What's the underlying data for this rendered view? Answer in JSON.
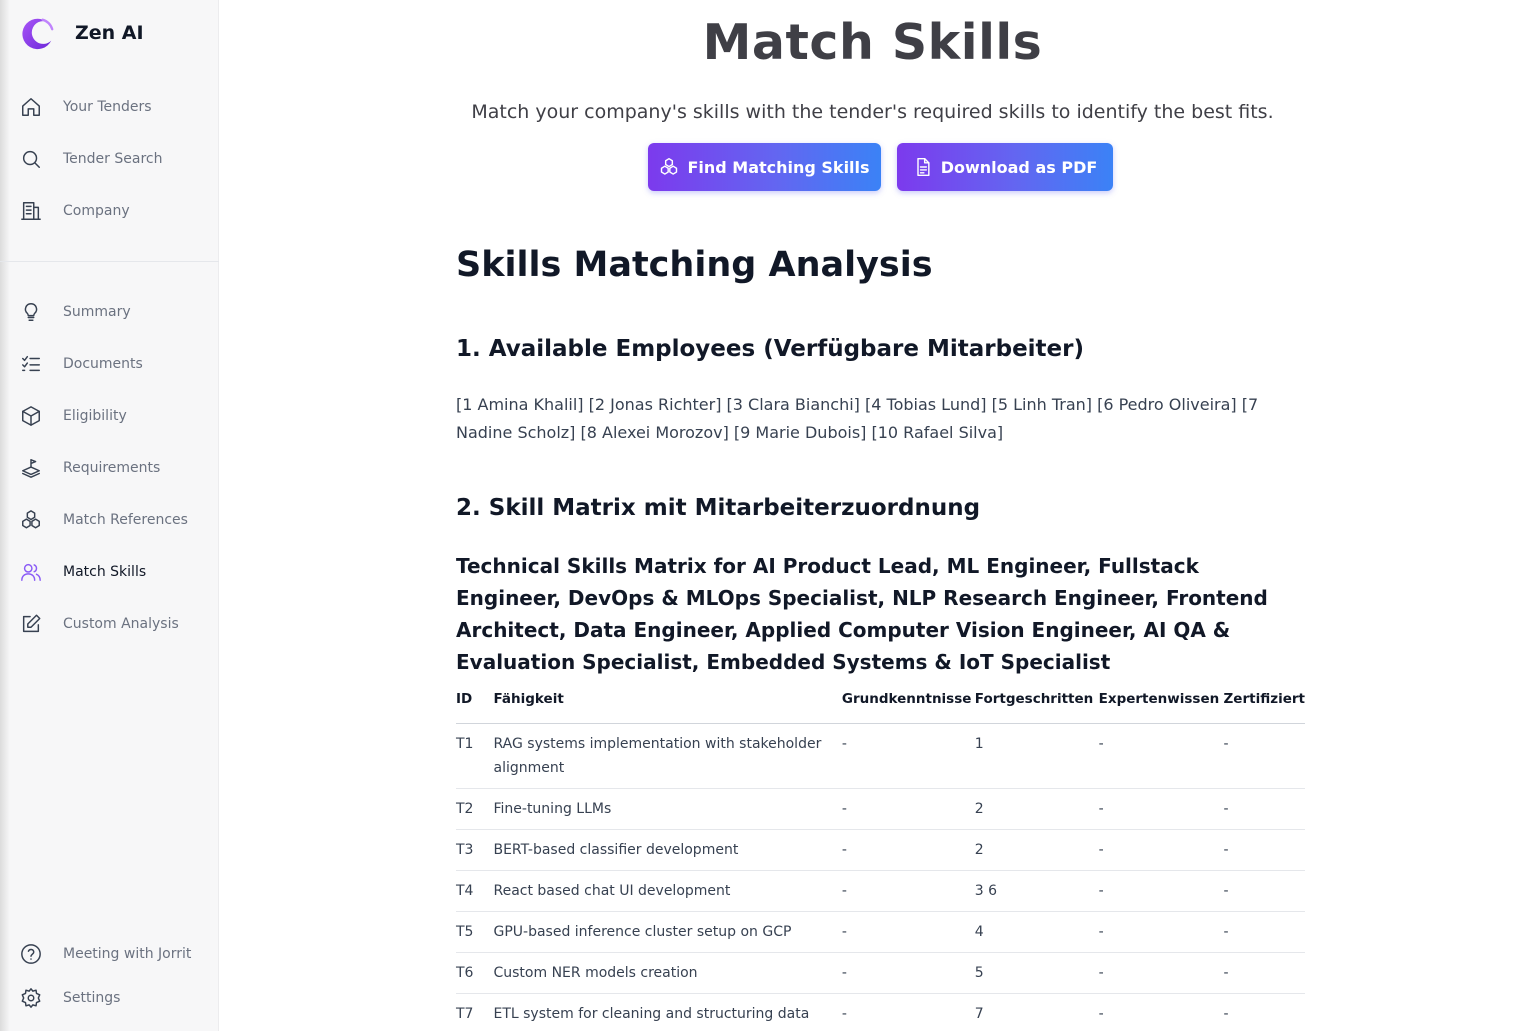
{
  "app": {
    "name": "Zen AI"
  },
  "sidebar": {
    "top_items": [
      {
        "label": "Your Tenders",
        "icon": "home-icon"
      },
      {
        "label": "Tender Search",
        "icon": "search-icon"
      },
      {
        "label": "Company",
        "icon": "building-icon"
      }
    ],
    "items": [
      {
        "label": "Summary",
        "icon": "lightbulb-icon"
      },
      {
        "label": "Documents",
        "icon": "checklist-icon"
      },
      {
        "label": "Eligibility",
        "icon": "cube-icon"
      },
      {
        "label": "Requirements",
        "icon": "layers-flag-icon"
      },
      {
        "label": "Match References",
        "icon": "boxes-icon"
      },
      {
        "label": "Match Skills",
        "icon": "users-icon",
        "active": true
      },
      {
        "label": "Custom Analysis",
        "icon": "edit-icon"
      }
    ],
    "bottom_items": [
      {
        "label": "Meeting with Jorrit",
        "icon": "help-circle-icon"
      },
      {
        "label": "Settings",
        "icon": "gear-icon"
      }
    ],
    "accent_color": "#8b5cf6"
  },
  "header": {
    "title": "Match Skills",
    "subtitle": "Match your company's skills with the tender's required skills to identify the best fits.",
    "find_button": "Find Matching Skills",
    "pdf_button": "Download as PDF"
  },
  "report": {
    "title": "Skills Matching Analysis",
    "section1_title": "1. Available Employees (Verfügbare Mitarbeiter)",
    "employees": "[1 Amina Khalil] [2 Jonas Richter] [3 Clara Bianchi] [4 Tobias Lund] [5 Linh Tran] [6 Pedro Oliveira] [7 Nadine Scholz] [8 Alexei Morozov] [9 Marie Dubois] [10 Rafael Silva]",
    "section2_title": "2. Skill Matrix mit Mitarbeiterzuordnung",
    "matrix_title": "Technical Skills Matrix for AI Product Lead, ML Engineer, Fullstack Engineer, DevOps & MLOps Specialist, NLP Research Engineer, Frontend Architect, Data Engineer, Applied Computer Vision Engineer, AI QA & Evaluation Specialist, Embedded Systems & IoT Specialist",
    "table": {
      "headers": [
        "ID",
        "Fähigkeit",
        "Grundkenntnisse",
        "Fortgeschritten",
        "Expertenwissen",
        "Zertifiziert"
      ],
      "rows": [
        [
          "T1",
          "RAG systems implementation with stakeholder alignment",
          "-",
          "1",
          "-",
          "-"
        ],
        [
          "T2",
          "Fine-tuning LLMs",
          "-",
          "2",
          "-",
          "-"
        ],
        [
          "T3",
          "BERT-based classifier development",
          "-",
          "2",
          "-",
          "-"
        ],
        [
          "T4",
          "React based chat UI development",
          "-",
          "3 6",
          "-",
          "-"
        ],
        [
          "T5",
          "GPU-based inference cluster setup on GCP",
          "-",
          "4",
          "-",
          "-"
        ],
        [
          "T6",
          "Custom NER models creation",
          "-",
          "5",
          "-",
          "-"
        ],
        [
          "T7",
          "ETL system for cleaning and structuring data for",
          "-",
          "7",
          "-",
          "-"
        ]
      ]
    }
  }
}
